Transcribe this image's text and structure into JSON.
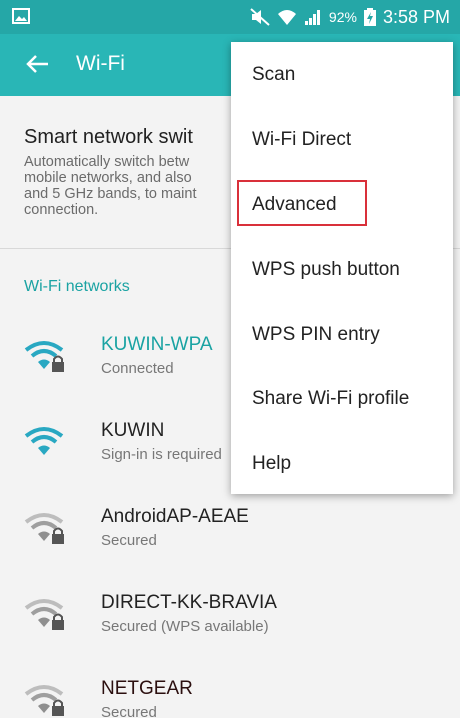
{
  "status_bar": {
    "battery": "92%",
    "time": "3:58 PM"
  },
  "action_bar": {
    "title": "Wi-Fi"
  },
  "smart_switch": {
    "title": "Smart network swit",
    "description_lines": [
      "Automatically switch betw",
      "mobile networks, and also",
      "and 5 GHz bands, to maint",
      "connection."
    ]
  },
  "section_label": "Wi-Fi networks",
  "networks": [
    {
      "name": "KUWIN-WPA",
      "status": "Connected",
      "secure": true,
      "strength": "full",
      "name_color": "#1aa3a3"
    },
    {
      "name": "KUWIN",
      "status": "Sign-in is required",
      "secure": false,
      "strength": "full",
      "name_color": "#222222"
    },
    {
      "name": "AndroidAP-AEAE",
      "status": "Secured",
      "secure": true,
      "strength": "weak",
      "name_color": "#222222"
    },
    {
      "name": "DIRECT-KK-BRAVIA",
      "status": "Secured (WPS available)",
      "secure": true,
      "strength": "weak",
      "name_color": "#222222"
    },
    {
      "name": "NETGEAR",
      "status": "Secured",
      "secure": true,
      "strength": "weak",
      "name_color": "#2b0f0f"
    }
  ],
  "menu": {
    "items": [
      "Scan",
      "Wi-Fi Direct",
      "Advanced",
      "WPS push button",
      "WPS PIN entry",
      "Share Wi-Fi profile",
      "Help"
    ],
    "highlighted": "Advanced",
    "highlight_color": "#d9303a"
  },
  "colors": {
    "status_bar": "#25a7a7",
    "action_bar": "#29b6b6",
    "accent": "#1aa3a3"
  }
}
